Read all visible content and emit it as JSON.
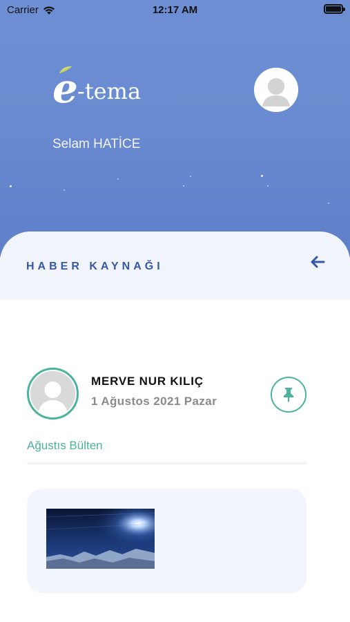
{
  "status_bar": {
    "carrier": "Carrier",
    "time": "12:17 AM",
    "battery_level": 1.0
  },
  "app": {
    "logo_text": "e-tema",
    "logo_initial": "e",
    "logo_rest": "-tema"
  },
  "header": {
    "greeting": "Selam HATİCE"
  },
  "panel": {
    "section_title": "HABER KAYNAĞI"
  },
  "post": {
    "author": "MERVE NUR KILIÇ",
    "date": "1 Ağustos 2021 Pazar",
    "title": "Ağustıs Bülten"
  },
  "icons": {
    "back": "arrow-left-icon",
    "pin": "pin-icon",
    "wifi": "wifi-icon",
    "battery": "battery-icon",
    "avatar": "user-avatar-icon"
  },
  "colors": {
    "header_bg": "#6a8bd1",
    "accent_blue": "#3457a8",
    "accent_green": "#4ab39b",
    "panel_head_bg": "#f2f4fb",
    "card_bg": "#f3f5fc"
  }
}
